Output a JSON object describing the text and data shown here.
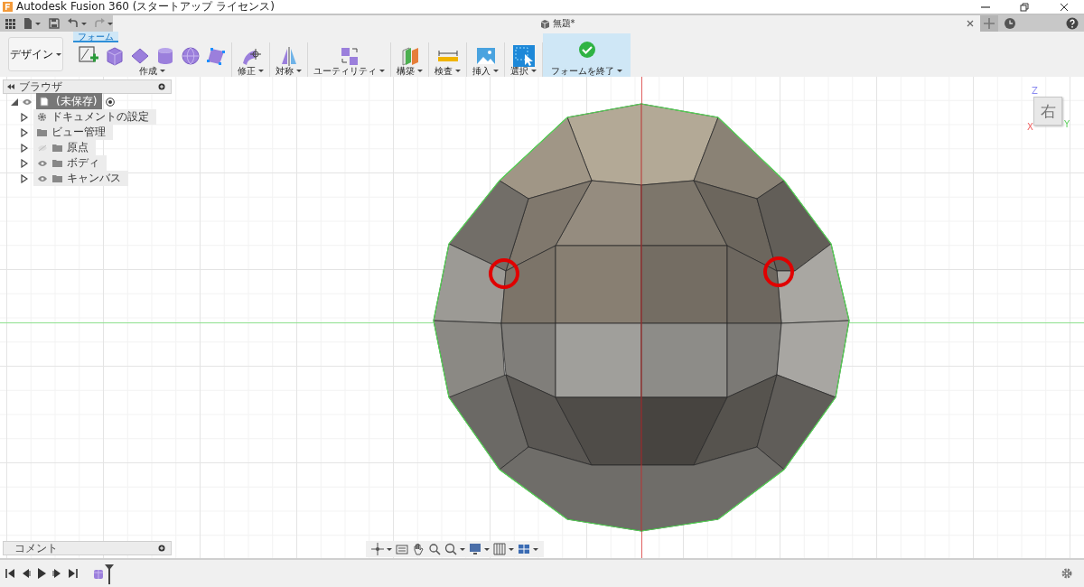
{
  "window": {
    "title": "Autodesk Fusion 360 (スタートアップ ライセンス)"
  },
  "document_tab": {
    "title": "無題*",
    "selected": true
  },
  "workspace_button": {
    "label": "デザイン"
  },
  "toolbar_tabs": [
    {
      "label": "フォーム",
      "selected": true
    }
  ],
  "toolbar_groups": [
    {
      "kind": "create",
      "label": "作成"
    },
    {
      "kind": "modify",
      "label": "修正"
    },
    {
      "kind": "symmetry",
      "label": "対称"
    },
    {
      "kind": "utility",
      "label": "ユーティリティ"
    },
    {
      "kind": "construct",
      "label": "構築"
    },
    {
      "kind": "inspect",
      "label": "検査"
    },
    {
      "kind": "insert",
      "label": "挿入"
    },
    {
      "kind": "select",
      "label": "選択"
    },
    {
      "kind": "finish",
      "label": "フォームを終了"
    }
  ],
  "browser": {
    "title": "ブラウザ",
    "root": {
      "label": "(未保存)",
      "visible": true,
      "expanded": true
    },
    "items": [
      {
        "kind": "settings",
        "label": "ドキュメントの設定"
      },
      {
        "kind": "folder",
        "label": "ビュー管理"
      },
      {
        "kind": "folder",
        "label": "原点",
        "visible": false
      },
      {
        "kind": "folder",
        "label": "ボディ",
        "visible": true
      },
      {
        "kind": "folder",
        "label": "キャンバス",
        "visible": true
      }
    ]
  },
  "comments_panel": {
    "title": "コメント"
  },
  "view_cube": {
    "face": "右",
    "axes": [
      "Z",
      "X",
      "Y"
    ]
  }
}
